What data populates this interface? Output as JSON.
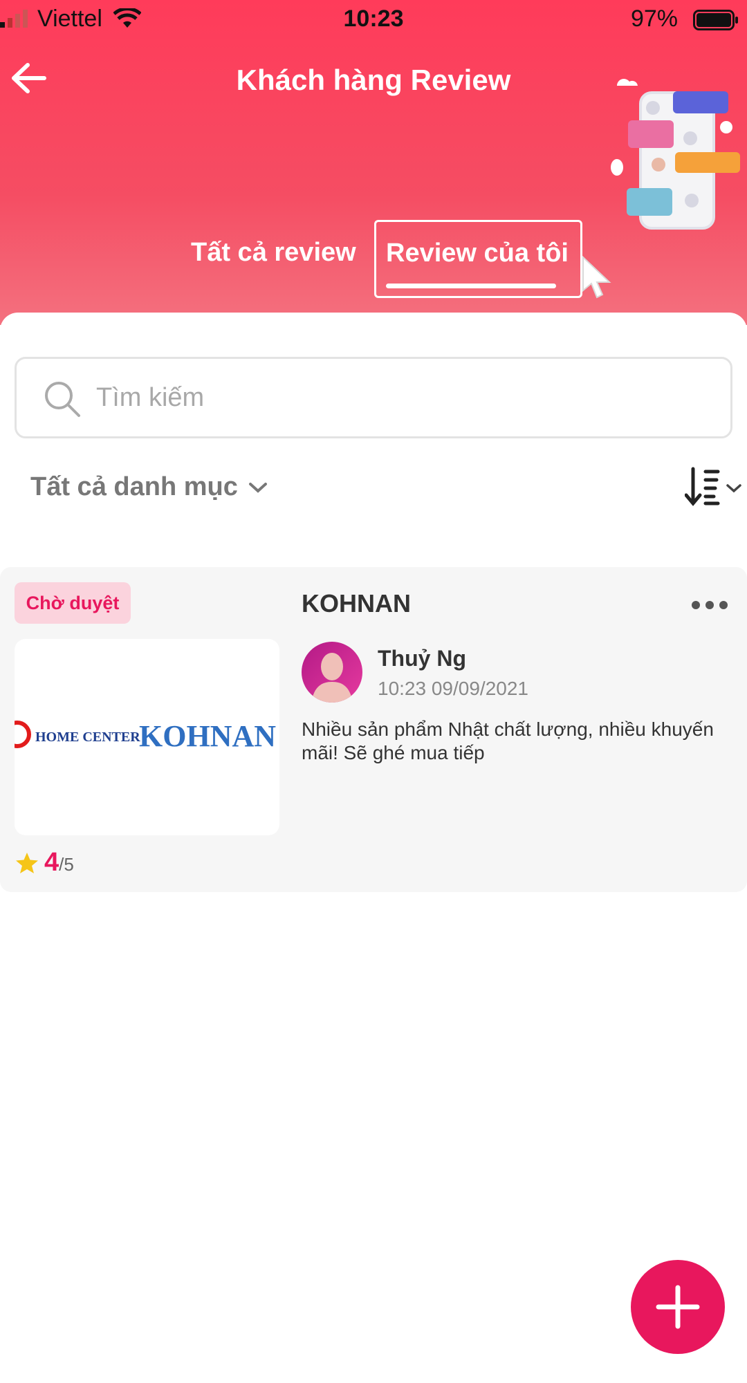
{
  "status_bar": {
    "carrier": "Viettel",
    "time": "10:23",
    "battery": "97%"
  },
  "header": {
    "title": "Khách hàng Review",
    "back_icon": "arrow-left-icon"
  },
  "tabs": [
    {
      "label": "Tất cả review",
      "active": false
    },
    {
      "label": "Review của tôi",
      "active": true
    }
  ],
  "search": {
    "placeholder": "Tìm kiếm",
    "value": ""
  },
  "filter": {
    "category": "Tất cả danh mục",
    "sort_icon": "sort-descending-icon"
  },
  "reviews": [
    {
      "status": "Chờ duyệt",
      "store": "KOHNAN",
      "logo_text": {
        "left": "HOME CENTER",
        "right": "KOHNAN"
      },
      "rating": "4",
      "rating_max": "/5",
      "user": "Thuỷ Ng",
      "date": "10:23 09/09/2021",
      "text": "Nhiều sản phẩm Nhật chất lượng, nhiều khuyến mãi! Sẽ ghé mua tiếp"
    }
  ],
  "colors": {
    "primary": "#e8175d",
    "header_top": "#ff3b5a",
    "header_bottom": "#f4717f",
    "star": "#f5c518"
  }
}
